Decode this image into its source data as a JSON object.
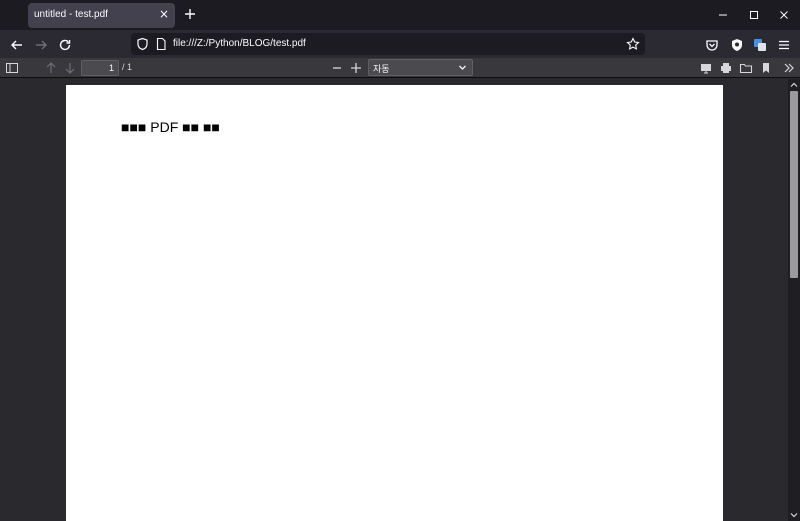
{
  "tab": {
    "title": "untitled - test.pdf",
    "close_glyph": "×"
  },
  "icons": {
    "new_tab": "plus-icon",
    "minimize": "minimize-icon",
    "maximize": "maximize-icon",
    "close": "close-icon",
    "back": "back-arrow-icon",
    "forward": "forward-arrow-icon",
    "reload": "reload-icon",
    "shield": "shield-icon",
    "page": "page-icon",
    "bookmark_star": "star-icon",
    "pocket": "pocket-icon",
    "extension_shield": "extension-shield-icon",
    "translate": "translate-icon",
    "menu": "hamburger-menu-icon"
  },
  "urlbar": {
    "url": "file:///Z:/Python/BLOG/test.pdf"
  },
  "pdf_toolbar": {
    "page_input": "1",
    "page_count": "/ 1",
    "zoom_value": "자동"
  },
  "document": {
    "text": "■■■ PDF ■■ ■■"
  },
  "colors": {
    "titlebar": "#1c1b22",
    "navbar": "#2b2a33",
    "pdf_toolbar": "#38383d",
    "viewer_bg": "#2a2a2e",
    "page": "#ffffff"
  }
}
